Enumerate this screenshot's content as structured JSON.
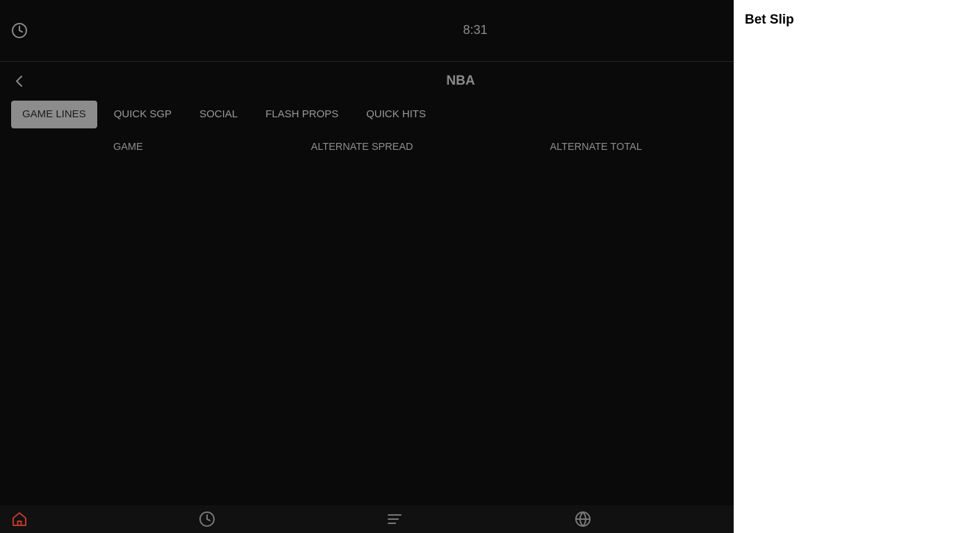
{
  "topbar": {
    "time": "8:31",
    "clock_icon": "clock-icon"
  },
  "header": {
    "title": "NBA",
    "back_icon": "chevron-left-icon"
  },
  "tabs": [
    {
      "label": "GAME LINES",
      "active": true
    },
    {
      "label": "QUICK SGP",
      "active": false
    },
    {
      "label": "SOCIAL",
      "active": false
    },
    {
      "label": "FLASH PROPS",
      "active": false
    },
    {
      "label": "QUICK HITS",
      "active": false
    }
  ],
  "columns": [
    "GAME",
    "ALTERNATE SPREAD",
    "ALTERNATE TOTAL"
  ],
  "bottom_nav": [
    {
      "icon": "home-icon",
      "active": true
    },
    {
      "icon": "clock-icon",
      "active": false
    },
    {
      "icon": "menu-icon",
      "active": false
    },
    {
      "icon": "globe-icon",
      "active": false
    }
  ],
  "colors": {
    "background": "#0a0a0a",
    "active_tab": "#8c8c8c",
    "home_active": "#c0392b",
    "betslip_bg": "#ffffff"
  },
  "betslip": {
    "title": "Bet Slip"
  }
}
